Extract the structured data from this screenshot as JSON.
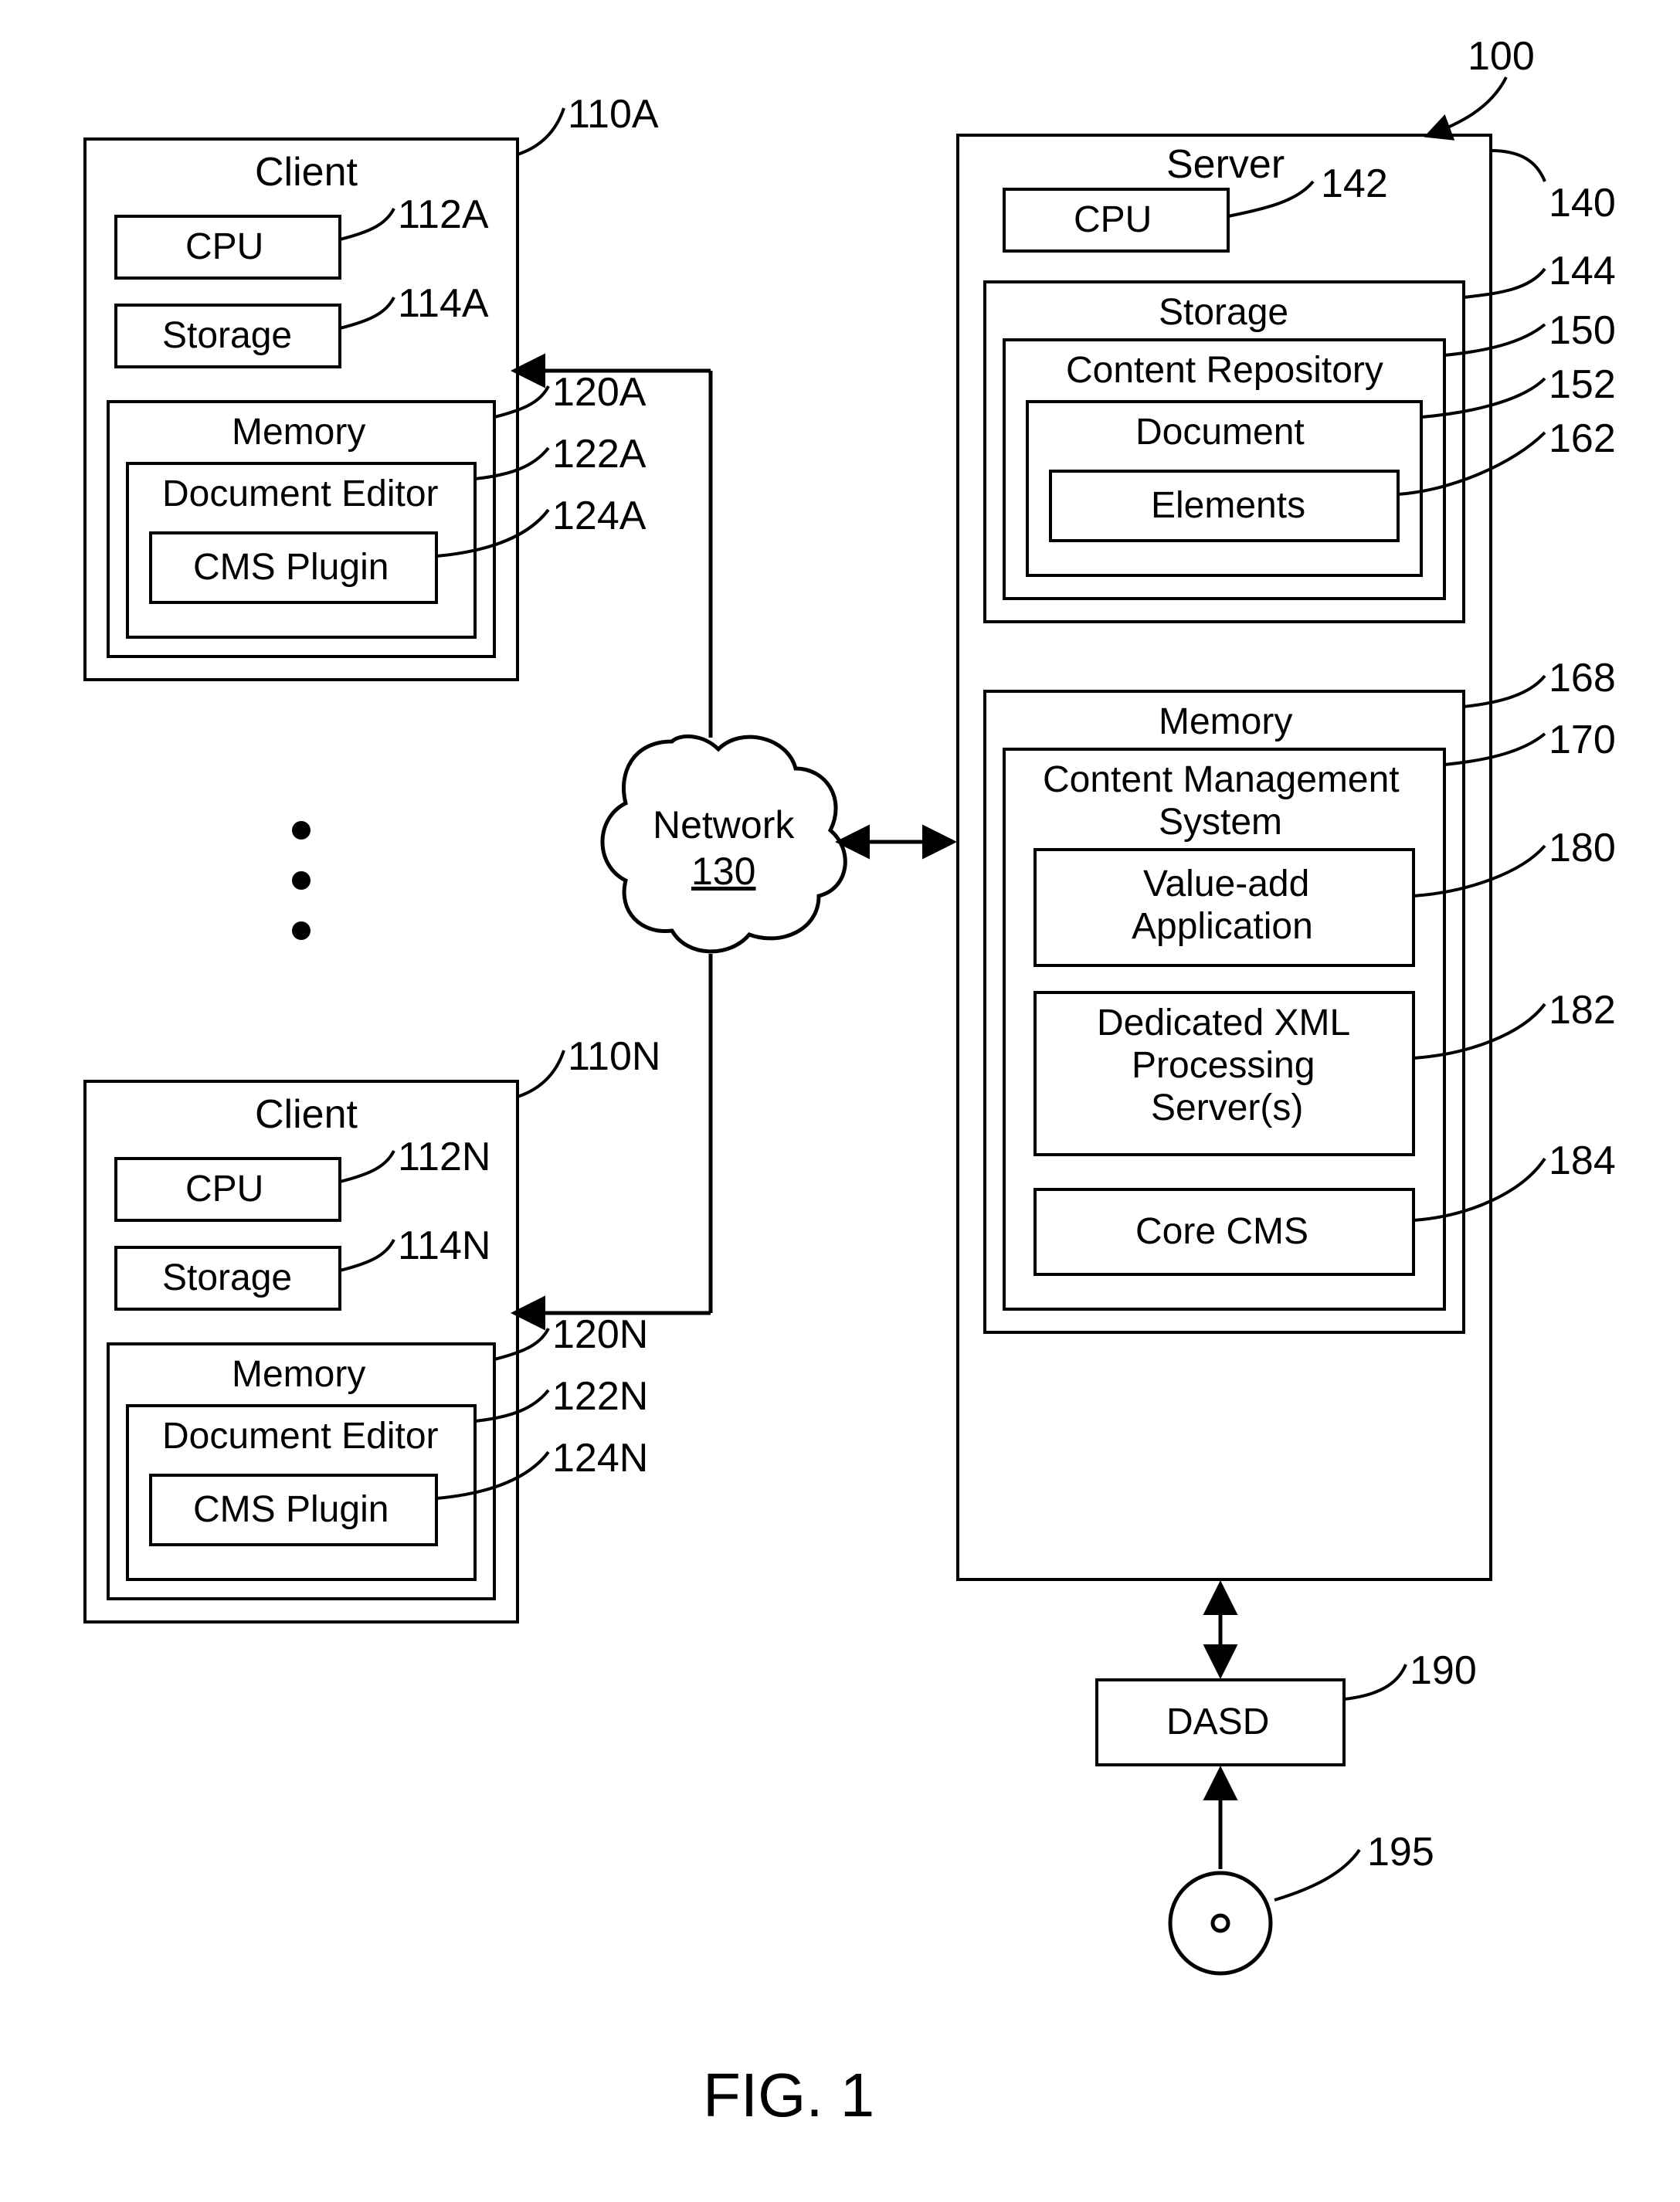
{
  "figure_label": "FIG. 1",
  "system_ref": "100",
  "clientA": {
    "title": "Client",
    "ref": "110A",
    "cpu": "CPU",
    "cpu_ref": "112A",
    "storage": "Storage",
    "storage_ref": "114A",
    "memory": "Memory",
    "memory_ref": "120A",
    "editor": "Document Editor",
    "editor_ref": "122A",
    "plugin": "CMS Plugin",
    "plugin_ref": "124A"
  },
  "clientN": {
    "title": "Client",
    "ref": "110N",
    "cpu": "CPU",
    "cpu_ref": "112N",
    "storage": "Storage",
    "storage_ref": "114N",
    "memory": "Memory",
    "memory_ref": "120N",
    "editor": "Document Editor",
    "editor_ref": "122N",
    "plugin": "CMS Plugin",
    "plugin_ref": "124N"
  },
  "network": {
    "label": "Network",
    "ref": "130"
  },
  "server": {
    "title": "Server",
    "ref": "140",
    "cpu": "CPU",
    "cpu_ref": "142",
    "storage": "Storage",
    "storage_ref": "144",
    "repo": "Content Repository",
    "repo_ref": "150",
    "document": "Document",
    "document_ref": "152",
    "elements": "Elements",
    "elements_ref": "162",
    "memory": "Memory",
    "memory_ref": "168",
    "cms_title1": "Content Management",
    "cms_title2": "System",
    "cms_ref": "170",
    "valueadd1": "Value-add",
    "valueadd2": "Application",
    "valueadd_ref": "180",
    "xml1": "Dedicated XML",
    "xml2": "Processing",
    "xml3": "Server(s)",
    "xml_ref": "182",
    "core": "Core CMS",
    "core_ref": "184"
  },
  "dasd": {
    "label": "DASD",
    "ref": "190"
  },
  "disc_ref": "195"
}
